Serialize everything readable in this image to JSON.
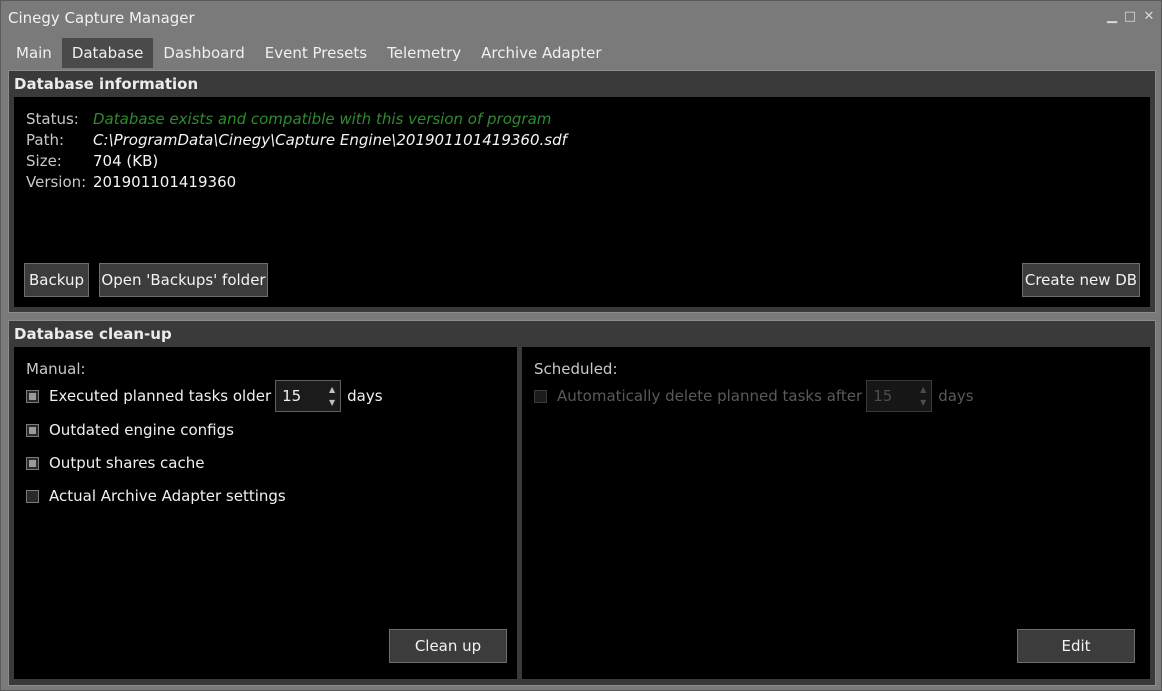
{
  "window": {
    "title": "Cinegy Capture Manager",
    "minimize_glyph": "▁",
    "maximize_glyph": "□",
    "close_glyph": "✕"
  },
  "tabs": [
    {
      "label": "Main"
    },
    {
      "label": "Database"
    },
    {
      "label": "Dashboard"
    },
    {
      "label": "Event Presets"
    },
    {
      "label": "Telemetry"
    },
    {
      "label": "Archive Adapter"
    }
  ],
  "active_tab": "Database",
  "database_info": {
    "heading": "Database information",
    "status_label": "Status:",
    "status_value": "Database exists and compatible with this version of program",
    "path_label": "Path:",
    "path_value": "C:\\ProgramData\\Cinegy\\Capture Engine\\201901101419360.sdf",
    "size_label": "Size:",
    "size_value": "704 (KB)",
    "version_label": "Version:",
    "version_value": "201901101419360",
    "backup_button": "Backup",
    "open_backups_button": "Open 'Backups' folder",
    "create_db_button": "Create new DB"
  },
  "cleanup": {
    "heading": "Database clean-up",
    "manual": {
      "label": "Manual:",
      "items": [
        {
          "label": "Executed planned tasks older",
          "checked": true,
          "spinner_value": "15",
          "suffix": "days"
        },
        {
          "label": "Outdated engine configs",
          "checked": true
        },
        {
          "label": "Output shares cache",
          "checked": true
        },
        {
          "label": "Actual Archive Adapter settings",
          "checked": false
        }
      ],
      "button": "Clean up"
    },
    "scheduled": {
      "label": "Scheduled:",
      "item": {
        "label": "Automatically delete planned tasks after",
        "checked": false,
        "enabled": false,
        "spinner_value": "15",
        "suffix": "days"
      },
      "button": "Edit"
    }
  },
  "colors": {
    "status_ok": "#2e8b2e",
    "panel_bg": "#000000",
    "chrome": "#7a7a7a"
  }
}
